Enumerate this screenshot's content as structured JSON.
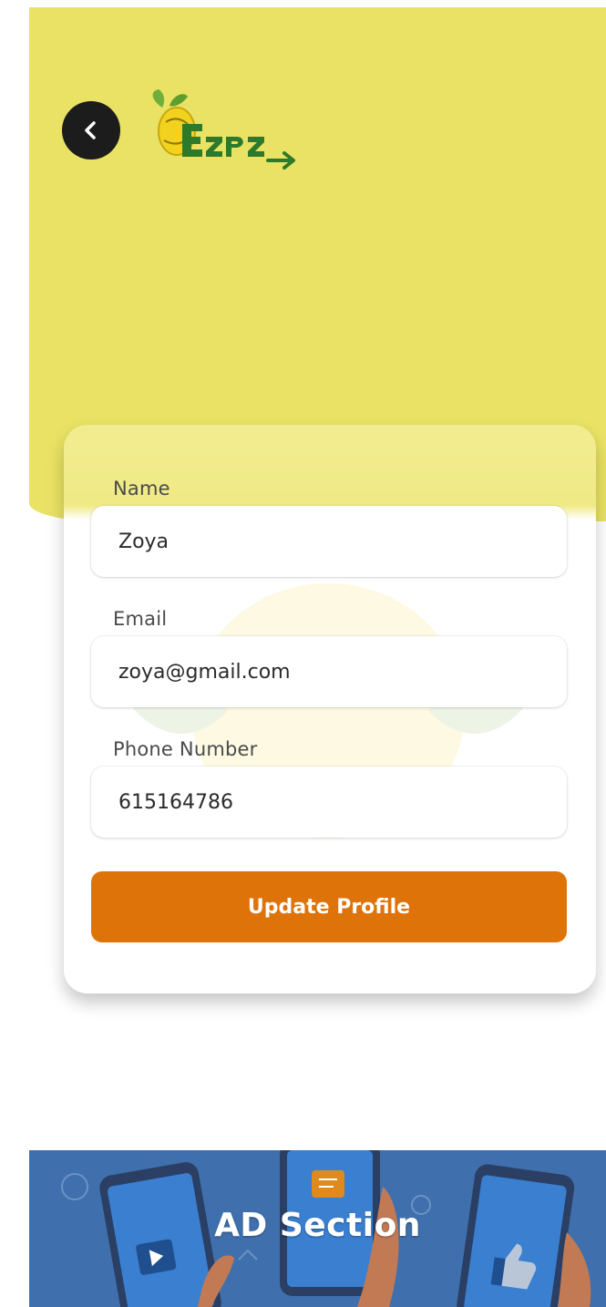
{
  "header": {
    "back_icon": "chevron-left-icon",
    "logo_text": "EZPZ"
  },
  "form": {
    "name_label": "Name",
    "name_value": "Zoya",
    "email_label": "Email",
    "email_value": "zoya@gmail.com",
    "phone_label": "Phone Number",
    "phone_value": "615164786",
    "update_label": "Update Profile"
  },
  "ad": {
    "title": "AD Section"
  },
  "colors": {
    "hero_yellow": "#e9e264",
    "button_orange": "#de7309",
    "ad_blue": "#3f70ad",
    "back_button": "#1c1c1c"
  }
}
